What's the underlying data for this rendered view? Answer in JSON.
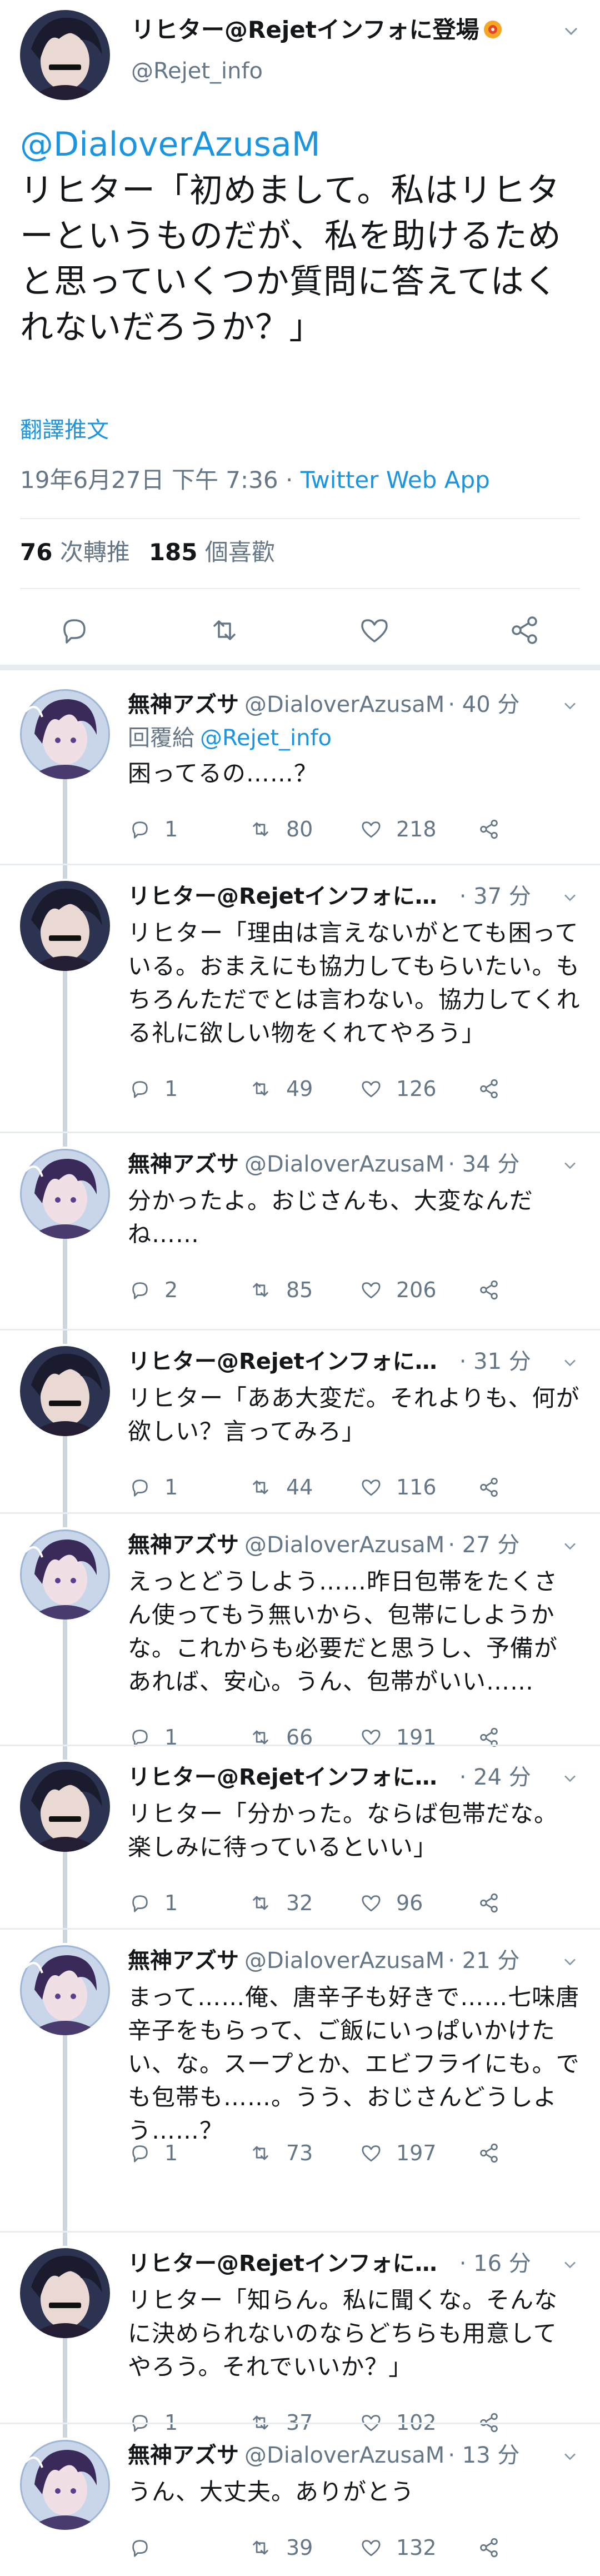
{
  "main_tweet": {
    "display_name": "リヒター@Rejetインフォに登場",
    "handle": "@Rejet_info",
    "mention": "@DialoverAzusaM",
    "text": "リヒター「初めまして。私はリヒターというものだが、私を助けるためと思っていくつか質問に答えてはくれないだろうか？」",
    "translate_label": "翻譯推文",
    "date": "19年6月27日 下午 7:36",
    "dot": " · ",
    "source": "Twitter Web App",
    "retweets_count": "76",
    "retweets_label": "次轉推",
    "likes_count": "185",
    "likes_label": "個喜歡",
    "accent_color": "#1b95e0"
  },
  "replies": [
    {
      "name": "無神アズサ",
      "handle": "@DialoverAzusaM",
      "time": "· 40 分",
      "replying_to_label": "回覆給",
      "replying_to": "@Rejet_info",
      "text": "困ってるの……？",
      "replies": "1",
      "retweets": "80",
      "likes": "218"
    },
    {
      "name": "リヒター@Rejetインフォに…",
      "handle": "",
      "time": "· 37 分",
      "text": "リヒター「理由は言えないがとても困っている。おまえにも協力してもらいたい。もちろんただでとは言わない。協力してくれる礼に欲しい物をくれてやろう」",
      "replies": "1",
      "retweets": "49",
      "likes": "126"
    },
    {
      "name": "無神アズサ",
      "handle": "@DialoverAzusaM",
      "time": "· 34 分",
      "text": "分かったよ。おじさんも、大変なんだね……",
      "replies": "2",
      "retweets": "85",
      "likes": "206"
    },
    {
      "name": "リヒター@Rejetインフォに…",
      "handle": "",
      "time": "· 31 分",
      "text": "リヒター「ああ大変だ。それよりも、何が欲しい？言ってみろ」",
      "replies": "1",
      "retweets": "44",
      "likes": "116"
    },
    {
      "name": "無神アズサ",
      "handle": "@DialoverAzusaM",
      "time": "· 27 分",
      "text": "えっとどうしよう……昨日包帯をたくさん使ってもう無いから、包帯にしようかな。これからも必要だと思うし、予備があれば、安心。うん、包帯がいい……",
      "replies": "1",
      "retweets": "66",
      "likes": "191"
    },
    {
      "name": "リヒター@Rejetインフォに…",
      "handle": "",
      "time": "· 24 分",
      "text": "リヒター「分かった。ならば包帯だな。楽しみに待っているといい」",
      "replies": "1",
      "retweets": "32",
      "likes": "96"
    },
    {
      "name": "無神アズサ",
      "handle": "@DialoverAzusaM",
      "time": "· 21 分",
      "text": "まって……俺、唐辛子も好きで……七味唐辛子をもらって、ご飯にいっぱいかけたい、な。スープとか、エビフライにも。でも包帯も……。うう、おじさんどうしよう……？",
      "replies": "1",
      "retweets": "73",
      "likes": "197"
    },
    {
      "name": "リヒター@Rejetインフォに…",
      "handle": "",
      "time": "· 16 分",
      "text": "リヒター「知らん。私に聞くな。そんなに決められないのならどちらも用意してやろう。それでいいか？」",
      "replies": "1",
      "retweets": "37",
      "likes": "102"
    },
    {
      "name": "無神アズサ",
      "handle": "@DialoverAzusaM",
      "time": "· 13 分",
      "text": "うん、大丈夫。ありがとう",
      "replies": "",
      "retweets": "39",
      "likes": "132"
    }
  ]
}
